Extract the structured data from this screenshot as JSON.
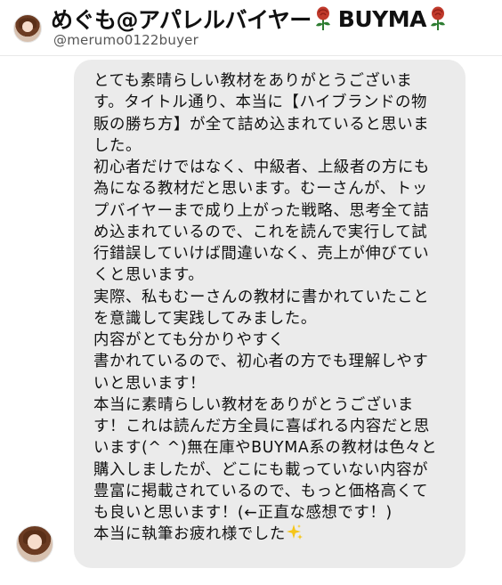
{
  "profile": {
    "display_name": "めぐも@アパレルバイヤー",
    "brand": "BUYMA",
    "handle": "@merumo0122buyer"
  },
  "message": {
    "lines": [
      "とても素晴らしい教材をありがとうございま",
      "す。タイトル通り、本当に【ハイブランドの物",
      "販の勝ち方】が全て詰め込まれていると思いま",
      "した。",
      "初心者だけではなく、中級者、上級者の方にも",
      "為になる教材だと思います。むーさんが、トッ",
      "プバイヤーまで成り上がった戦略、思考全て詰",
      "め込まれているので、これを読んで実行して試",
      "行錯誤していけば間違いなく、売上が伸びてい",
      "くと思います。",
      "実際、私もむーさんの教材に書かれていたこと",
      "を意識して実践してみました。",
      "内容がとても分かりやすく",
      "書かれているので、初心者の方でも理解しやす",
      "いと思います！",
      "本当に素晴らしい教材をありがとうございま",
      "す！これは読んだ方全員に喜ばれる内容だと思",
      "います(^ ^)無在庫やBUYMA系の教材は色々と",
      "購入しましたが、どこにも載っていない内容が",
      "豊富に掲載されているので、もっと価格高くて",
      "も良いと思います！(←正直な感想です！)",
      "本当に執筆お疲れ様でした"
    ]
  },
  "icons": {
    "rose": "rose-icon",
    "sparkle": "sparkles-icon",
    "rose_color": "#c0392b",
    "sparkle_color": "#f5c518"
  }
}
